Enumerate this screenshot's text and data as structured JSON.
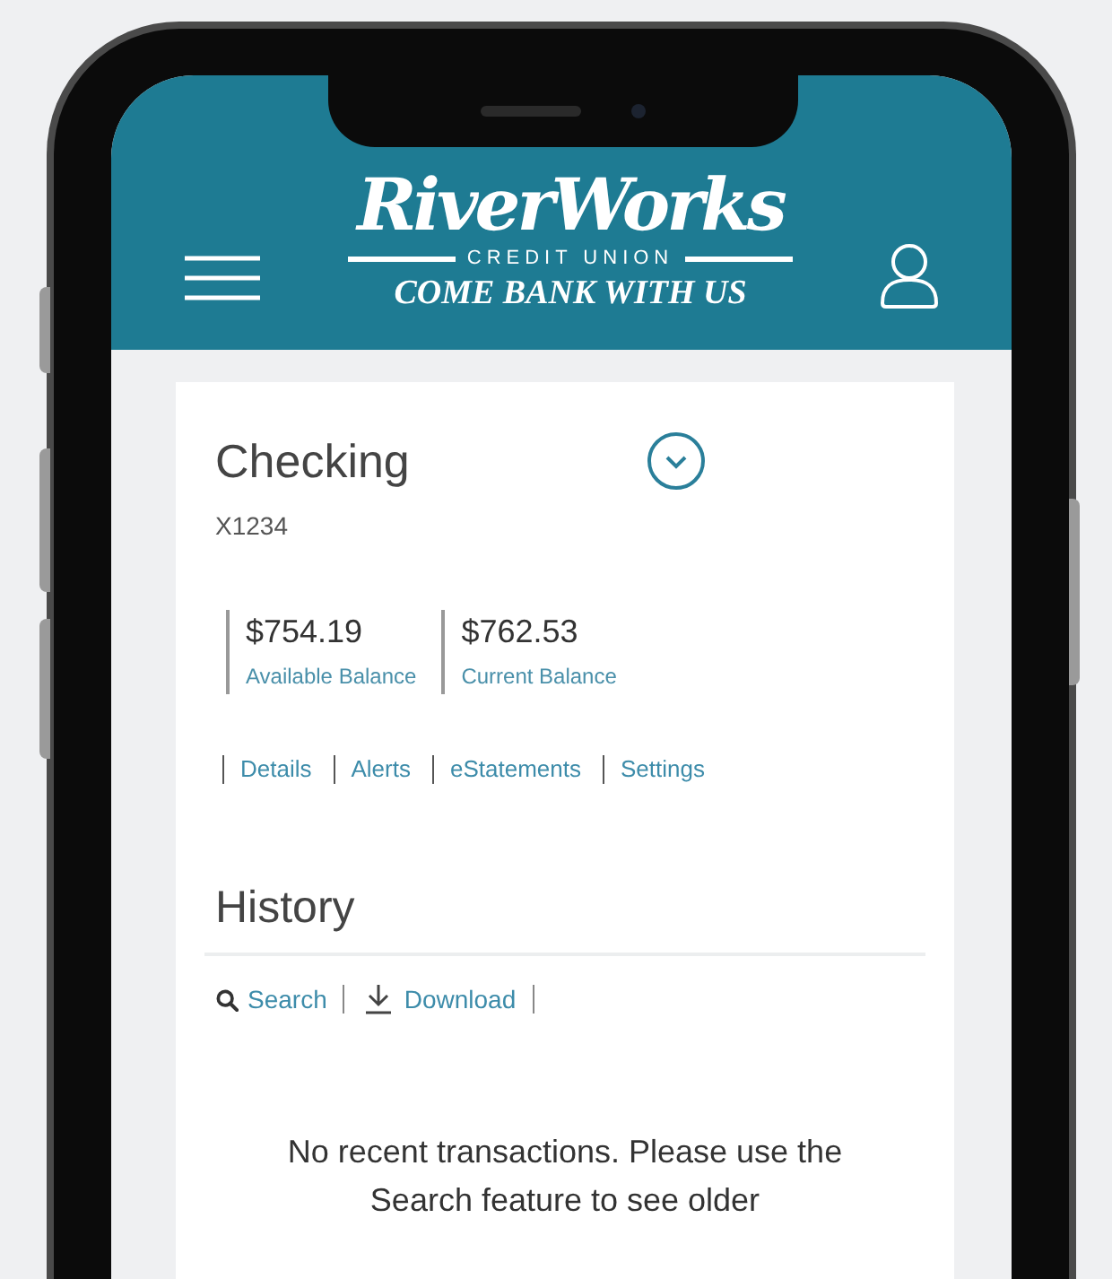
{
  "header": {
    "logo": {
      "name": "RiverWorks",
      "subtitle": "CREDIT UNION",
      "tagline": "COME BANK WITH US"
    }
  },
  "account": {
    "title": "Checking",
    "number": "X1234",
    "expanded": false,
    "balances": [
      {
        "amount": "$754.19",
        "label": "Available Balance"
      },
      {
        "amount": "$762.53",
        "label": "Current Balance"
      }
    ],
    "links": [
      "Details",
      "Alerts",
      "eStatements",
      "Settings"
    ]
  },
  "history": {
    "title": "History",
    "actions": [
      {
        "kind": "search",
        "label": "Search"
      },
      {
        "kind": "download",
        "label": "Download"
      }
    ],
    "empty_message": "No recent transactions. Please use the Search feature to see older"
  }
}
